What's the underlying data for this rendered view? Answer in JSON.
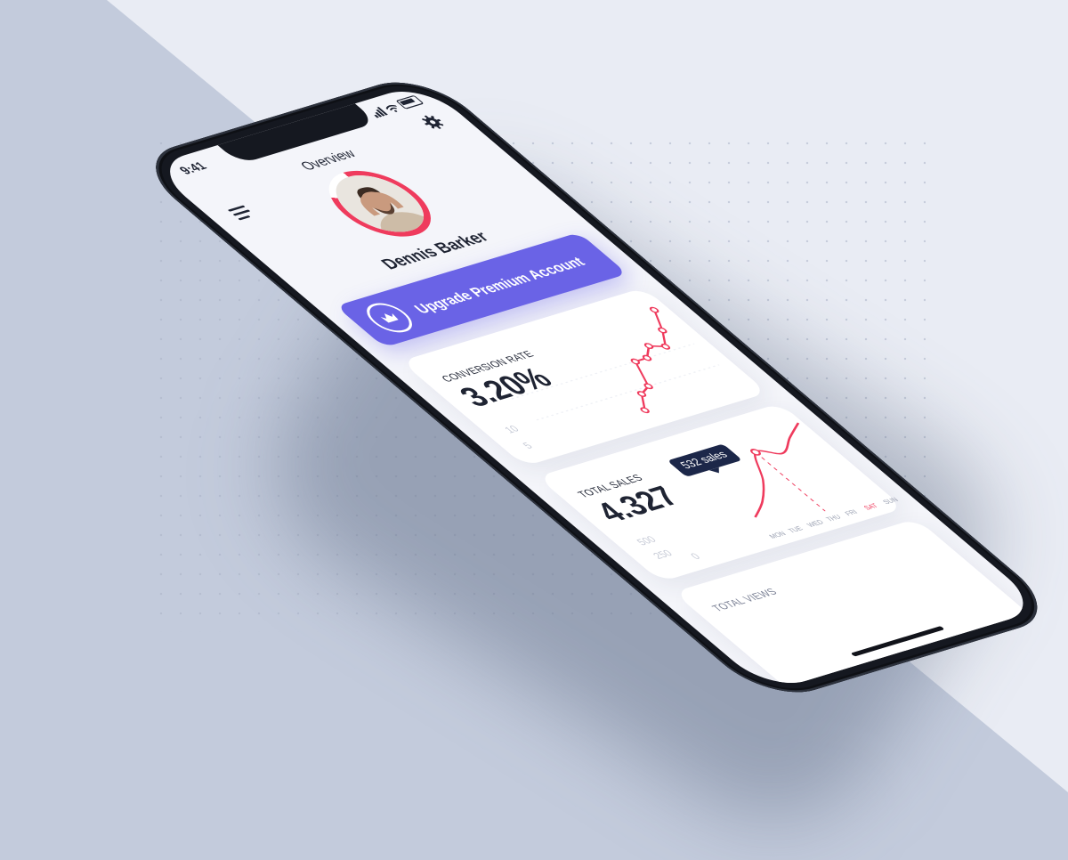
{
  "status": {
    "time": "9:41"
  },
  "header": {
    "title": "Overview"
  },
  "profile": {
    "name": "Dennis Barker"
  },
  "upgrade": {
    "label": "Upgrade Premium Account"
  },
  "conversion": {
    "label": "CONVERSION RATE",
    "value": "3.20%",
    "y_ticks": [
      "10",
      "5"
    ]
  },
  "sales": {
    "label": "TOTAL SALES",
    "value": "4.327",
    "y_ticks": [
      "500",
      "250",
      "0"
    ],
    "tooltip": "532 sales",
    "days": [
      "MON",
      "TUE",
      "WED",
      "THU",
      "FRI",
      "SAT",
      "SUN"
    ],
    "highlight_day": "SAT"
  },
  "views": {
    "label": "TOTAL VIEWS"
  },
  "colors": {
    "accent": "#ef3b5d",
    "primary": "#6a63e6",
    "dark": "#1c2749"
  },
  "icons": [
    "menu-icon",
    "gear-icon",
    "crown-icon",
    "signal-icon",
    "wifi-icon",
    "battery-icon"
  ],
  "chart_data": [
    {
      "type": "line",
      "title": "CONVERSION RATE",
      "x": [
        1,
        2,
        3,
        4,
        5,
        6,
        7,
        8,
        9
      ],
      "values": [
        1,
        4,
        5,
        10,
        10,
        12,
        11,
        14,
        18
      ],
      "ylim": [
        0,
        20
      ],
      "y_ticks": [
        5,
        10
      ]
    },
    {
      "type": "line",
      "title": "TOTAL SALES",
      "categories": [
        "MON",
        "TUE",
        "WED",
        "THU",
        "FRI",
        "SAT",
        "SUN"
      ],
      "values": [
        100,
        190,
        330,
        532,
        470,
        560,
        640
      ],
      "ylim": [
        0,
        700
      ],
      "y_ticks": [
        0,
        250,
        500
      ],
      "annotation": "532 sales"
    }
  ]
}
